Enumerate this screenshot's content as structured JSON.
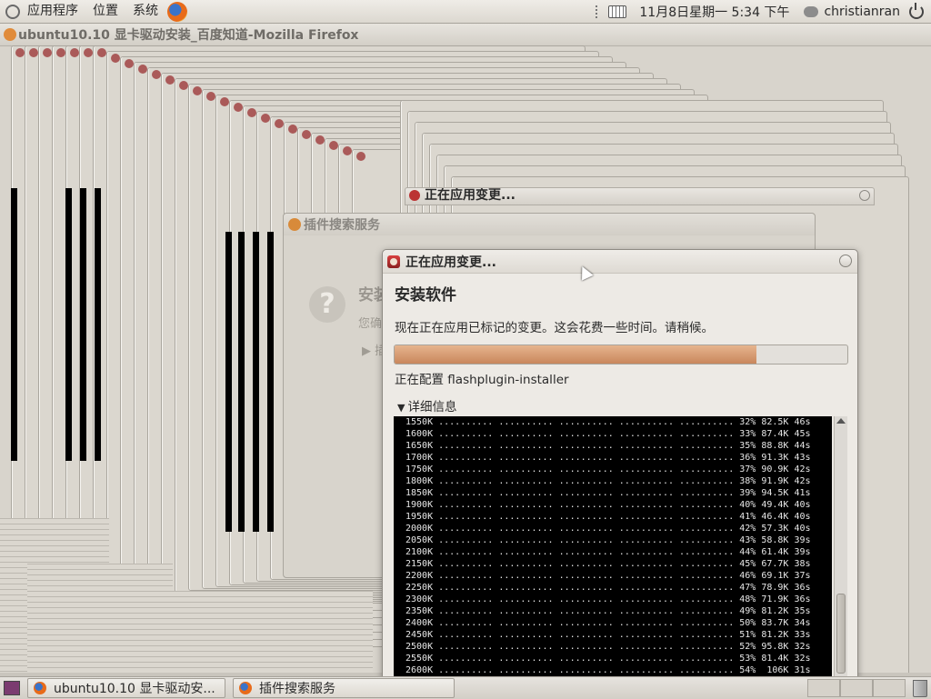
{
  "top_panel": {
    "menus": [
      "应用程序",
      "位置",
      "系统"
    ],
    "clock": "11月8日星期一  5:34 下午",
    "username": "christianran"
  },
  "firefox_window": {
    "title": "ubuntu10.10 显卡驱动安装_百度知道-Mozilla Firefox"
  },
  "plugin_window": {
    "title": "插件搜索服务",
    "heading": "安装",
    "description": "您确",
    "expander": "▶ 插"
  },
  "stacked_dialogs": {
    "title": "正在应用变更..."
  },
  "dialog": {
    "title": "正在应用变更...",
    "heading": "安装软件",
    "description": "现在正在应用已标记的变更。这会花费一些时间。请稍候。",
    "progress_percent": 80,
    "status": "正在配置 flashplugin-installer",
    "details_label": "详细信息",
    "terminal_lines": [
      "1550K .......... .......... .......... .......... .......... 32% 82.5K 46s",
      "1600K .......... .......... .......... .......... .......... 33% 87.4K 45s",
      "1650K .......... .......... .......... .......... .......... 35% 88.8K 44s",
      "1700K .......... .......... .......... .......... .......... 36% 91.3K 43s",
      "1750K .......... .......... .......... .......... .......... 37% 90.9K 42s",
      "1800K .......... .......... .......... .......... .......... 38% 91.9K 42s",
      "1850K .......... .......... .......... .......... .......... 39% 94.5K 41s",
      "1900K .......... .......... .......... .......... .......... 40% 49.4K 40s",
      "1950K .......... .......... .......... .......... .......... 41% 46.4K 40s",
      "2000K .......... .......... .......... .......... .......... 42% 57.3K 40s",
      "2050K .......... .......... .......... .......... .......... 43% 58.8K 39s",
      "2100K .......... .......... .......... .......... .......... 44% 61.4K 39s",
      "2150K .......... .......... .......... .......... .......... 45% 67.7K 38s",
      "2200K .......... .......... .......... .......... .......... 46% 69.1K 37s",
      "2250K .......... .......... .......... .......... .......... 47% 78.9K 36s",
      "2300K .......... .......... .......... .......... .......... 48% 71.9K 36s",
      "2350K .......... .......... .......... .......... .......... 49% 81.2K 35s",
      "2400K .......... .......... .......... .......... .......... 50% 83.7K 34s",
      "2450K .......... .......... .......... .......... .......... 51% 81.2K 33s",
      "2500K .......... .......... .......... .......... .......... 52% 95.8K 32s",
      "2550K .......... .......... .......... .......... .......... 53% 81.4K 32s",
      "2600K .......... .......... .......... .......... .......... 54%  106K 31s"
    ]
  },
  "taskbar": {
    "tasks": [
      "ubuntu10.10 显卡驱动安...",
      "插件搜索服务"
    ]
  }
}
